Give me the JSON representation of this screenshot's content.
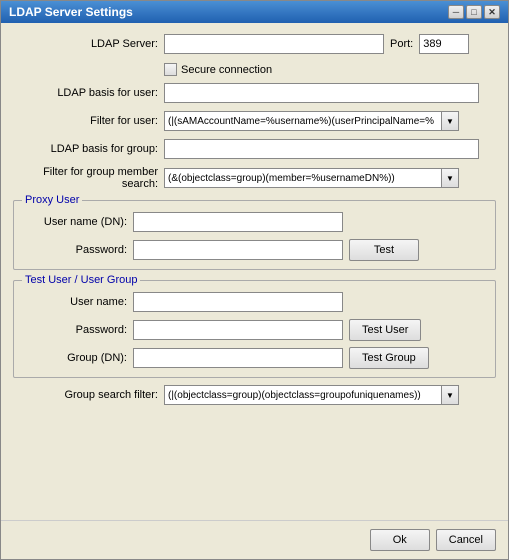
{
  "window": {
    "title": "LDAP Server Settings",
    "close_btn": "✕",
    "min_btn": "─",
    "max_btn": "□"
  },
  "form": {
    "ldap_server_label": "LDAP Server:",
    "ldap_server_value": "",
    "port_label": "Port:",
    "port_value": "389",
    "secure_label": "Secure connection",
    "ldap_basis_user_label": "LDAP basis for user:",
    "ldap_basis_user_value": "",
    "filter_user_label": "Filter for user:",
    "filter_user_value": "(|(sAMAccountName=%username%)(userPrincipalName=%",
    "ldap_basis_group_label": "LDAP basis for group:",
    "ldap_basis_group_value": "",
    "filter_group_label": "Filter for group member search:",
    "filter_group_value": "(&(objectclass=group)(member=%usernameDN%))",
    "dropdown_arrow": "▼"
  },
  "proxy_user": {
    "title": "Proxy User",
    "username_label": "User name (DN):",
    "username_value": "",
    "password_label": "Password:",
    "password_value": "",
    "test_btn": "Test"
  },
  "test_user_group": {
    "title": "Test User / User Group",
    "username_label": "User name:",
    "username_value": "",
    "password_label": "Password:",
    "password_value": "",
    "test_user_btn": "Test User",
    "group_label": "Group (DN):",
    "group_value": "",
    "test_group_btn": "Test Group"
  },
  "footer": {
    "group_search_label": "Group search filter:",
    "group_search_value": "(|(objectclass=group)(objectclass=groupofuniquenames))",
    "ok_btn": "Ok",
    "cancel_btn": "Cancel"
  }
}
